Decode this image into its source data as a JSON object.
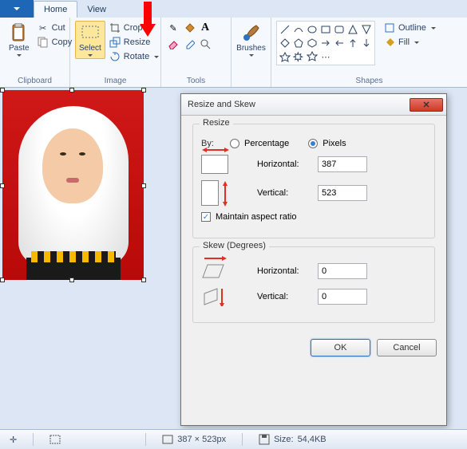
{
  "tabs": {
    "home": "Home",
    "view": "View"
  },
  "clipboard": {
    "paste": "Paste",
    "cut": "Cut",
    "copy": "Copy",
    "label": "Clipboard"
  },
  "image": {
    "select": "Select",
    "crop": "Crop",
    "resize": "Resize",
    "rotate": "Rotate",
    "label": "Image"
  },
  "tools": {
    "label": "Tools"
  },
  "brushes": {
    "label": "Brushes"
  },
  "shapes": {
    "label": "Shapes",
    "outline": "Outline",
    "fill": "Fill"
  },
  "dialog": {
    "title": "Resize and Skew",
    "resize": "Resize",
    "by": "By:",
    "percentage": "Percentage",
    "pixels": "Pixels",
    "horizontal": "Horizontal:",
    "vertical": "Vertical:",
    "maintain": "Maintain aspect ratio",
    "skew": "Skew (Degrees)",
    "h_val": "387",
    "v_val": "523",
    "skew_h": "0",
    "skew_v": "0",
    "ok": "OK",
    "cancel": "Cancel"
  },
  "status": {
    "dims": "387 × 523px",
    "size_label": "Size:",
    "size_val": "54,4KB"
  }
}
